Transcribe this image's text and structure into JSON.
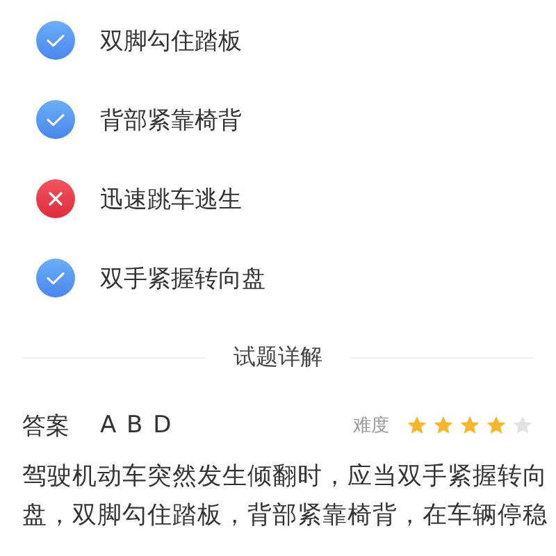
{
  "options": [
    {
      "label": "双脚勾住踏板",
      "kind": "correct"
    },
    {
      "label": "背部紧靠椅背",
      "kind": "correct"
    },
    {
      "label": "迅速跳车逃生",
      "kind": "wrong"
    },
    {
      "label": "双手紧握转向盘",
      "kind": "correct"
    }
  ],
  "section_title": "试题详解",
  "answer": {
    "label": "答案",
    "value": "A B D"
  },
  "difficulty": {
    "label": "难度",
    "stars": 4
  },
  "explanation_lines": [
    "驾驶机动车突然发生倾翻时，应当双手紧握转向",
    "盘，双脚勾住踏板，背部紧靠椅背，在车辆停稳"
  ]
}
